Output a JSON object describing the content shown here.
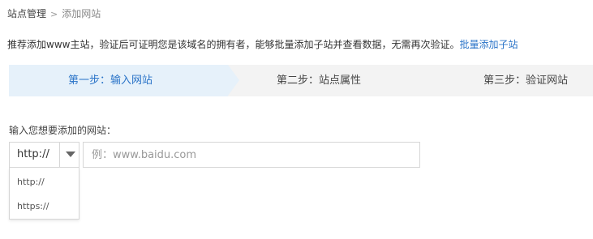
{
  "breadcrumb": {
    "parent": "站点管理",
    "separator": ">",
    "current": "添加网站"
  },
  "description": {
    "text": "推荐添加www主站，验证后可证明您是该域名的拥有者，能够批量添加子站并查看数据，无需再次验证。",
    "link_label": "批量添加子站"
  },
  "steps": [
    {
      "label": "第一步：输入网站",
      "active": true
    },
    {
      "label": "第二步：站点属性",
      "active": false
    },
    {
      "label": "第三步：验证网站",
      "active": false
    }
  ],
  "form": {
    "label": "输入您想要添加的网站：",
    "protocol_selected": "http://",
    "protocol_options": [
      "http://",
      "https://"
    ],
    "site_input_value": "",
    "site_input_placeholder": "例：www.baidu.com"
  },
  "colors": {
    "accent": "#2b74c8",
    "active_step_bg": "#e6f1fa",
    "steps_bar_bg": "#f3f3f3"
  }
}
